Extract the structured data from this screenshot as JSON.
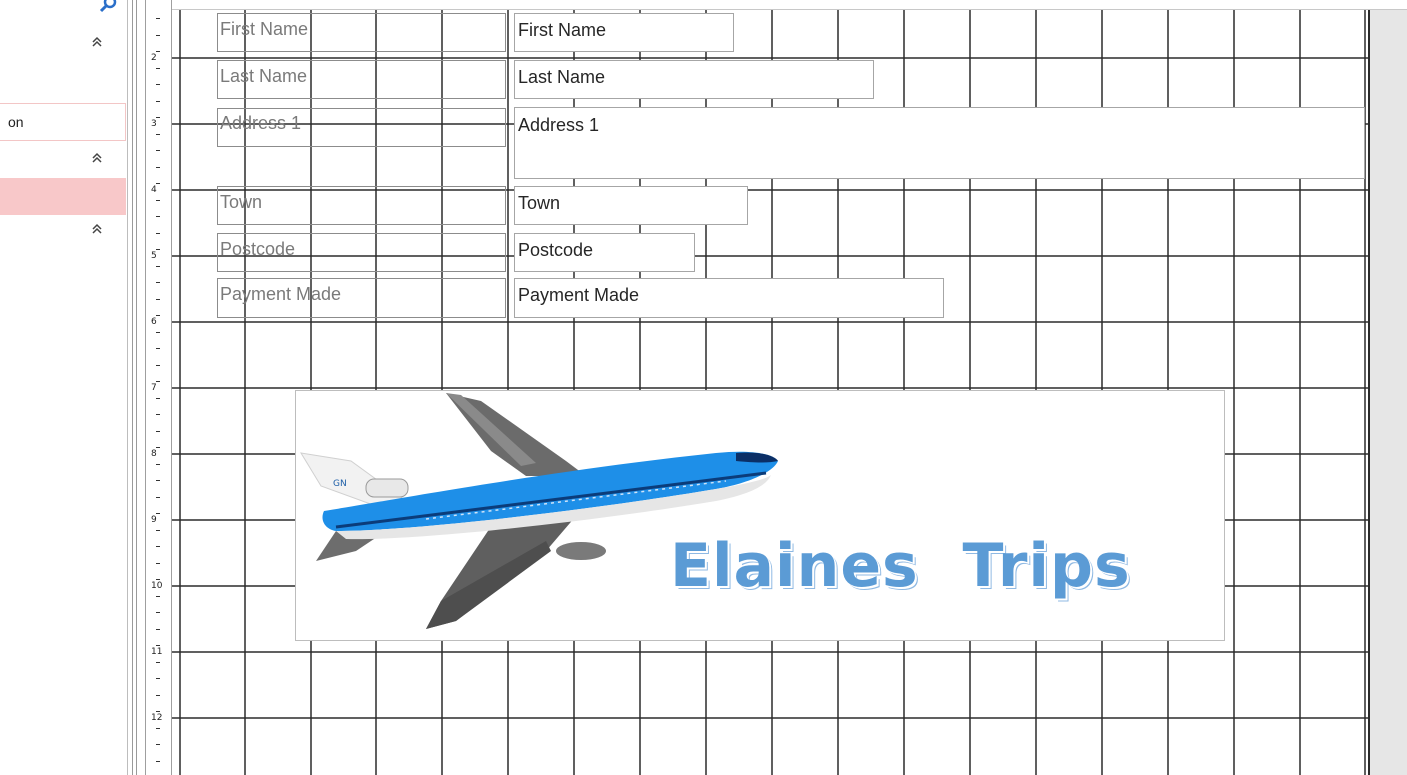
{
  "property_pane": {
    "row_text": "on",
    "search_icon": "search-icon",
    "collapse_icon": "double-chevron-up-icon",
    "collapse_glyph": "»"
  },
  "ruler": {
    "numbers": [
      "2",
      "3",
      "4",
      "5",
      "6",
      "7",
      "8",
      "9",
      "10",
      "11",
      "12"
    ]
  },
  "form": {
    "labels": {
      "first_name": "First Name",
      "last_name": "Last Name",
      "address1": "Address 1",
      "town": "Town",
      "postcode": "Postcode",
      "payment_made": "Payment Made"
    },
    "fields": {
      "first_name": "First Name",
      "last_name": "Last Name",
      "address1": "Address 1",
      "town": "Town",
      "postcode": "Postcode",
      "payment_made": "Payment Made"
    }
  },
  "logo": {
    "text": "Elaines  Trips",
    "tail_text": "GN",
    "colors": {
      "text": "#5b9bd5",
      "fuselage": "#1e8fe8",
      "wing": "#6b6b6b"
    }
  }
}
